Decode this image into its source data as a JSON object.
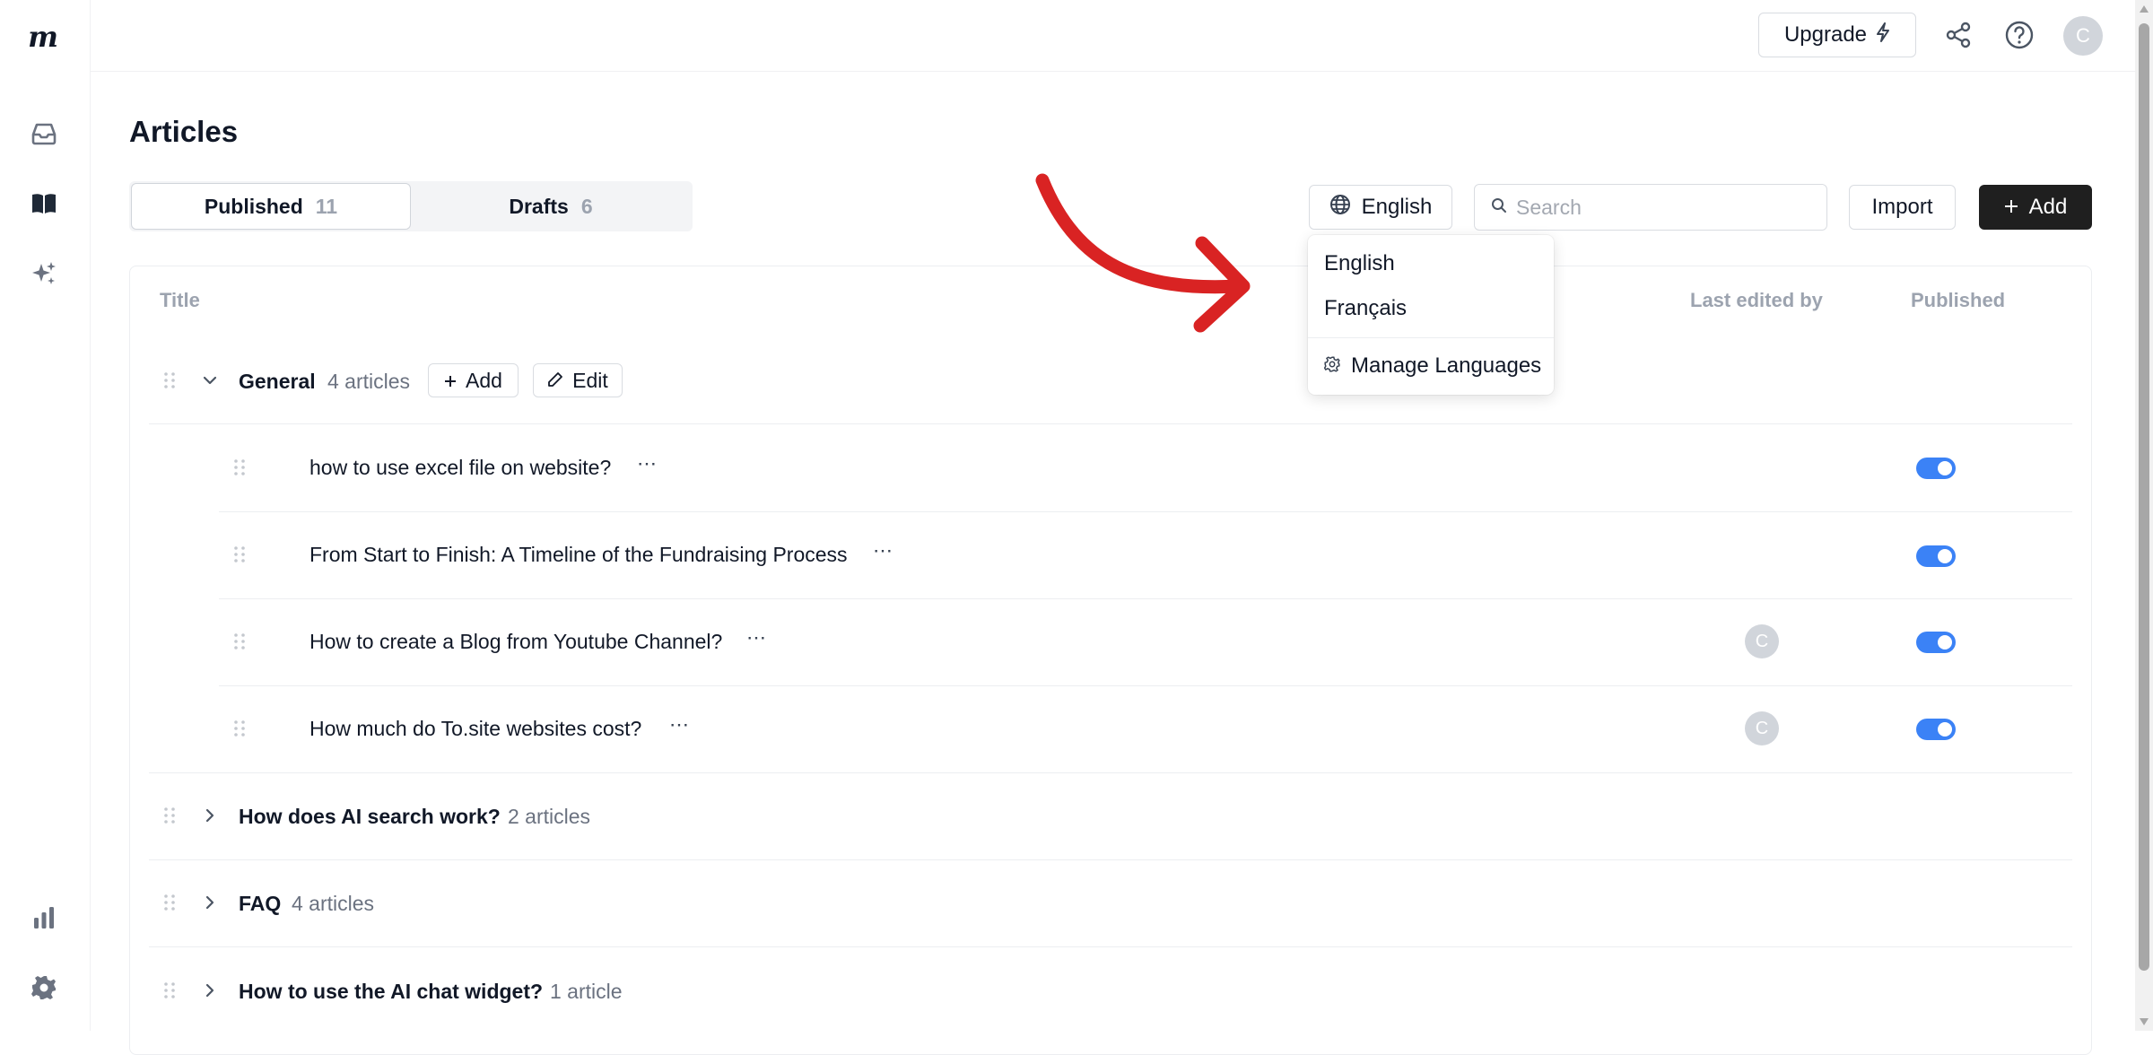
{
  "app": {
    "logo_letter": "m"
  },
  "sidebar": {
    "items": [
      {
        "icon": "inbox-icon"
      },
      {
        "icon": "book-icon"
      },
      {
        "icon": "sparkles-icon"
      },
      {
        "icon": "chart-icon"
      },
      {
        "icon": "gear-icon"
      }
    ]
  },
  "topbar": {
    "upgrade_label": "Upgrade",
    "avatar_initial": "C"
  },
  "page": {
    "title": "Articles"
  },
  "tabs": [
    {
      "label": "Published",
      "count": "11"
    },
    {
      "label": "Drafts",
      "count": "6"
    }
  ],
  "toolbar": {
    "language": "English",
    "search_placeholder": "Search",
    "import_label": "Import",
    "add_label": "Add"
  },
  "table": {
    "headers": {
      "title": "Title",
      "last_edited": "Last edited by",
      "published": "Published"
    }
  },
  "groups": [
    {
      "title": "General",
      "count": "4 articles",
      "expanded": true,
      "add_label": "Add",
      "edit_label": "Edit",
      "articles": [
        {
          "title": "how to use excel file on website?",
          "editor": "",
          "published": true
        },
        {
          "title": "From Start to Finish: A Timeline of the Fundraising Process",
          "editor": "",
          "published": true
        },
        {
          "title": "How to create a Blog from Youtube Channel?",
          "editor": "C",
          "published": true
        },
        {
          "title": "How much do To.site websites cost?",
          "editor": "C",
          "published": true
        }
      ]
    },
    {
      "title": "How does AI search work?",
      "count": "2 articles",
      "expanded": false
    },
    {
      "title": "FAQ",
      "count": "4 articles",
      "expanded": false
    },
    {
      "title": "How to use the AI chat widget?",
      "count": "1 article",
      "expanded": false
    }
  ],
  "language_dropdown": {
    "options": [
      "English",
      "Français"
    ],
    "manage_label": "Manage Languages"
  },
  "colors": {
    "accent": "#3b82f6",
    "primary_button": "#1f1f1f",
    "annotation_arrow": "#d92323"
  }
}
